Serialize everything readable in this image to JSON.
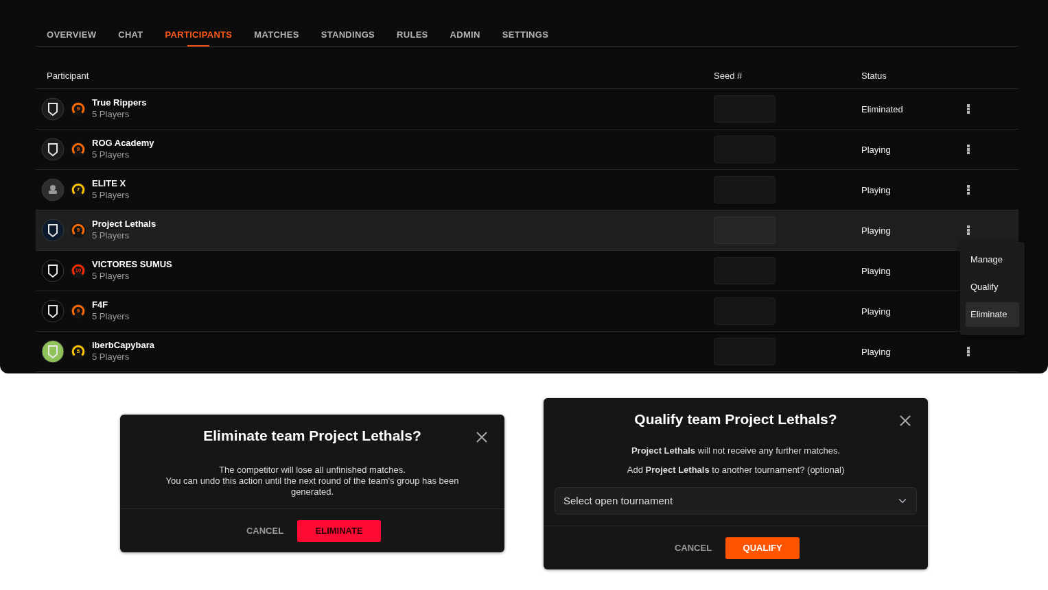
{
  "tabs": [
    {
      "label": "OVERVIEW",
      "selected": false
    },
    {
      "label": "CHAT",
      "selected": false
    },
    {
      "label": "PARTICIPANTS",
      "selected": true
    },
    {
      "label": "MATCHES",
      "selected": false
    },
    {
      "label": "STANDINGS",
      "selected": false
    },
    {
      "label": "RULES",
      "selected": false
    },
    {
      "label": "ADMIN",
      "selected": false
    },
    {
      "label": "SETTINGS",
      "selected": false
    }
  ],
  "table": {
    "columns": [
      "Participant",
      "Seed #",
      "Status"
    ],
    "rows": [
      {
        "name": "True Rippers",
        "players": "5 Players",
        "status": "Eliminated",
        "selected": false,
        "avatar": {
          "kind": "logo",
          "color": "#1c1c1c"
        },
        "rank": {
          "text": "9",
          "color": "#ff6a00"
        }
      },
      {
        "name": "ROG Academy",
        "players": "5 Players",
        "status": "Playing",
        "selected": false,
        "avatar": {
          "kind": "logo",
          "color": "#1c1c1c"
        },
        "rank": {
          "text": "9",
          "color": "#ff6a00"
        }
      },
      {
        "name": "ELITE X",
        "players": "5 Players",
        "status": "Playing",
        "selected": false,
        "avatar": {
          "kind": "placeholder",
          "color": "#2e2e2e"
        },
        "rank": {
          "text": "7",
          "color": "#ffc400"
        }
      },
      {
        "name": "Project Lethals",
        "players": "5 Players",
        "status": "Playing",
        "selected": true,
        "avatar": {
          "kind": "logo",
          "color": "#0d1a2e"
        },
        "rank": {
          "text": "9",
          "color": "#ff6a00"
        }
      },
      {
        "name": "VICTORES SUMUS",
        "players": "5 Players",
        "status": "Playing",
        "selected": false,
        "avatar": {
          "kind": "logo",
          "color": "#0a0a0a"
        },
        "rank": {
          "text": "10",
          "color": "#ff2a00"
        }
      },
      {
        "name": "F4F",
        "players": "5 Players",
        "status": "Playing",
        "selected": false,
        "avatar": {
          "kind": "logo",
          "color": "#0a0a0a"
        },
        "rank": {
          "text": "9",
          "color": "#ff6a00"
        }
      },
      {
        "name": "iberbCapybara",
        "players": "5 Players",
        "status": "Playing",
        "selected": false,
        "avatar": {
          "kind": "logo",
          "color": "#8fc25a"
        },
        "rank": {
          "text": "5",
          "color": "#ffc400"
        }
      }
    ]
  },
  "row_menu": {
    "items": [
      {
        "label": "Manage",
        "selected": false
      },
      {
        "label": "Qualify",
        "selected": false
      },
      {
        "label": "Eliminate",
        "selected": true
      }
    ]
  },
  "dialogs": [
    {
      "kind": "eliminate",
      "title": "Eliminate team Project Lethals?",
      "body": [
        "The competitor will lose all unfinished matches.\nYou can undo this action until the next round of the team's group has been generated."
      ],
      "cancel": "CANCEL",
      "confirm": "ELIMINATE"
    },
    {
      "kind": "qualify",
      "title": "Qualify team Project Lethals?",
      "body": [
        "**Project Lethals** will not receive any further matches.",
        "Add **Project Lethals** to another tournament? (optional)"
      ],
      "select": {
        "placeholder": "Select open tournament"
      },
      "cancel": "CANCEL",
      "confirm": "QUALIFY"
    }
  ]
}
